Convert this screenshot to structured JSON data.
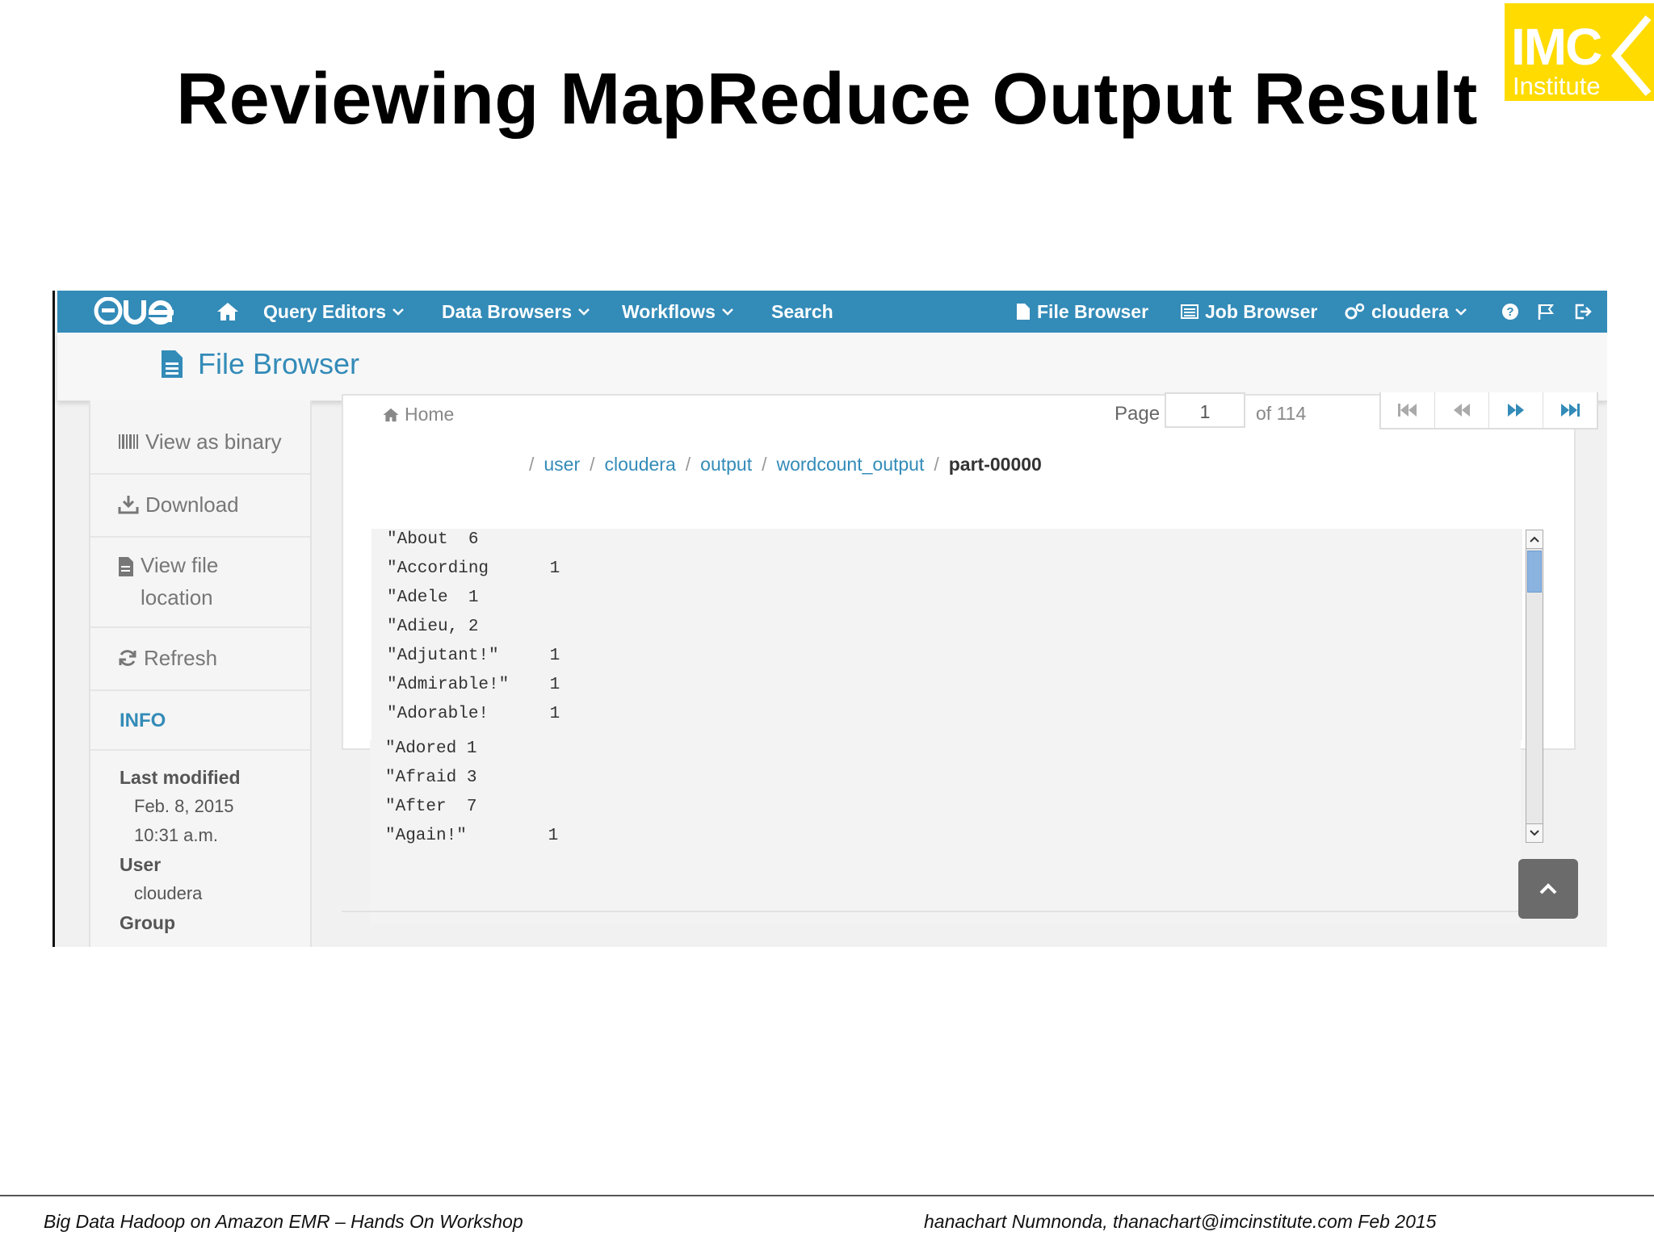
{
  "slide": {
    "title": "Reviewing MapReduce Output Result",
    "logo": {
      "main": "IMC",
      "sub": "Institute",
      "color": "#ffdb00"
    },
    "footer_left": "Big Data Hadoop on Amazon EMR – Hands On Workshop",
    "footer_right": "hanachart Numnonda,  thanachart@imcinstitute.com   Feb 2015"
  },
  "navbar": {
    "brand": "HUE",
    "items": [
      {
        "label": "Query Editors",
        "icon": "chevron-down-icon"
      },
      {
        "label": "Data Browsers",
        "icon": "chevron-down-icon"
      },
      {
        "label": "Workflows",
        "icon": "chevron-down-icon"
      },
      {
        "label": "Search"
      }
    ],
    "right": {
      "file_browser": "File Browser",
      "job_browser": "Job Browser",
      "user": "cloudera"
    },
    "color": "#338bb8"
  },
  "subheader": {
    "title": "File Browser"
  },
  "sidebar": {
    "actions": [
      {
        "label": "View as binary",
        "icon": "binary-icon"
      },
      {
        "label": "Download",
        "icon": "download-icon"
      },
      {
        "label": "View file location",
        "icon": "file-icon"
      },
      {
        "label": "Refresh",
        "icon": "refresh-icon"
      }
    ],
    "info_title": "INFO",
    "last_modified_label": "Last modified",
    "last_modified_date": "Feb. 8, 2015",
    "last_modified_time": "10:31 a.m.",
    "user_label": "User",
    "user_value": "cloudera",
    "group_label": "Group"
  },
  "content": {
    "home": "Home",
    "page_label": "Page",
    "page_value": "1",
    "page_total": "of 114",
    "breadcrumbs": [
      "user",
      "cloudera",
      "output",
      "wordcount_output"
    ],
    "current_file": "part-00000",
    "lines": [
      "\"About\t6",
      "\"According\t1",
      "\"Adele\t1",
      "\"Adieu,\t2",
      "\"Adjutant!\"\t1",
      "\"Admirable!\"\t1",
      "\"Adorable!\t1",
      "\"Adored\t1",
      "\"Afraid\t3",
      "\"After\t7",
      "\"Again!\"\t1"
    ]
  }
}
